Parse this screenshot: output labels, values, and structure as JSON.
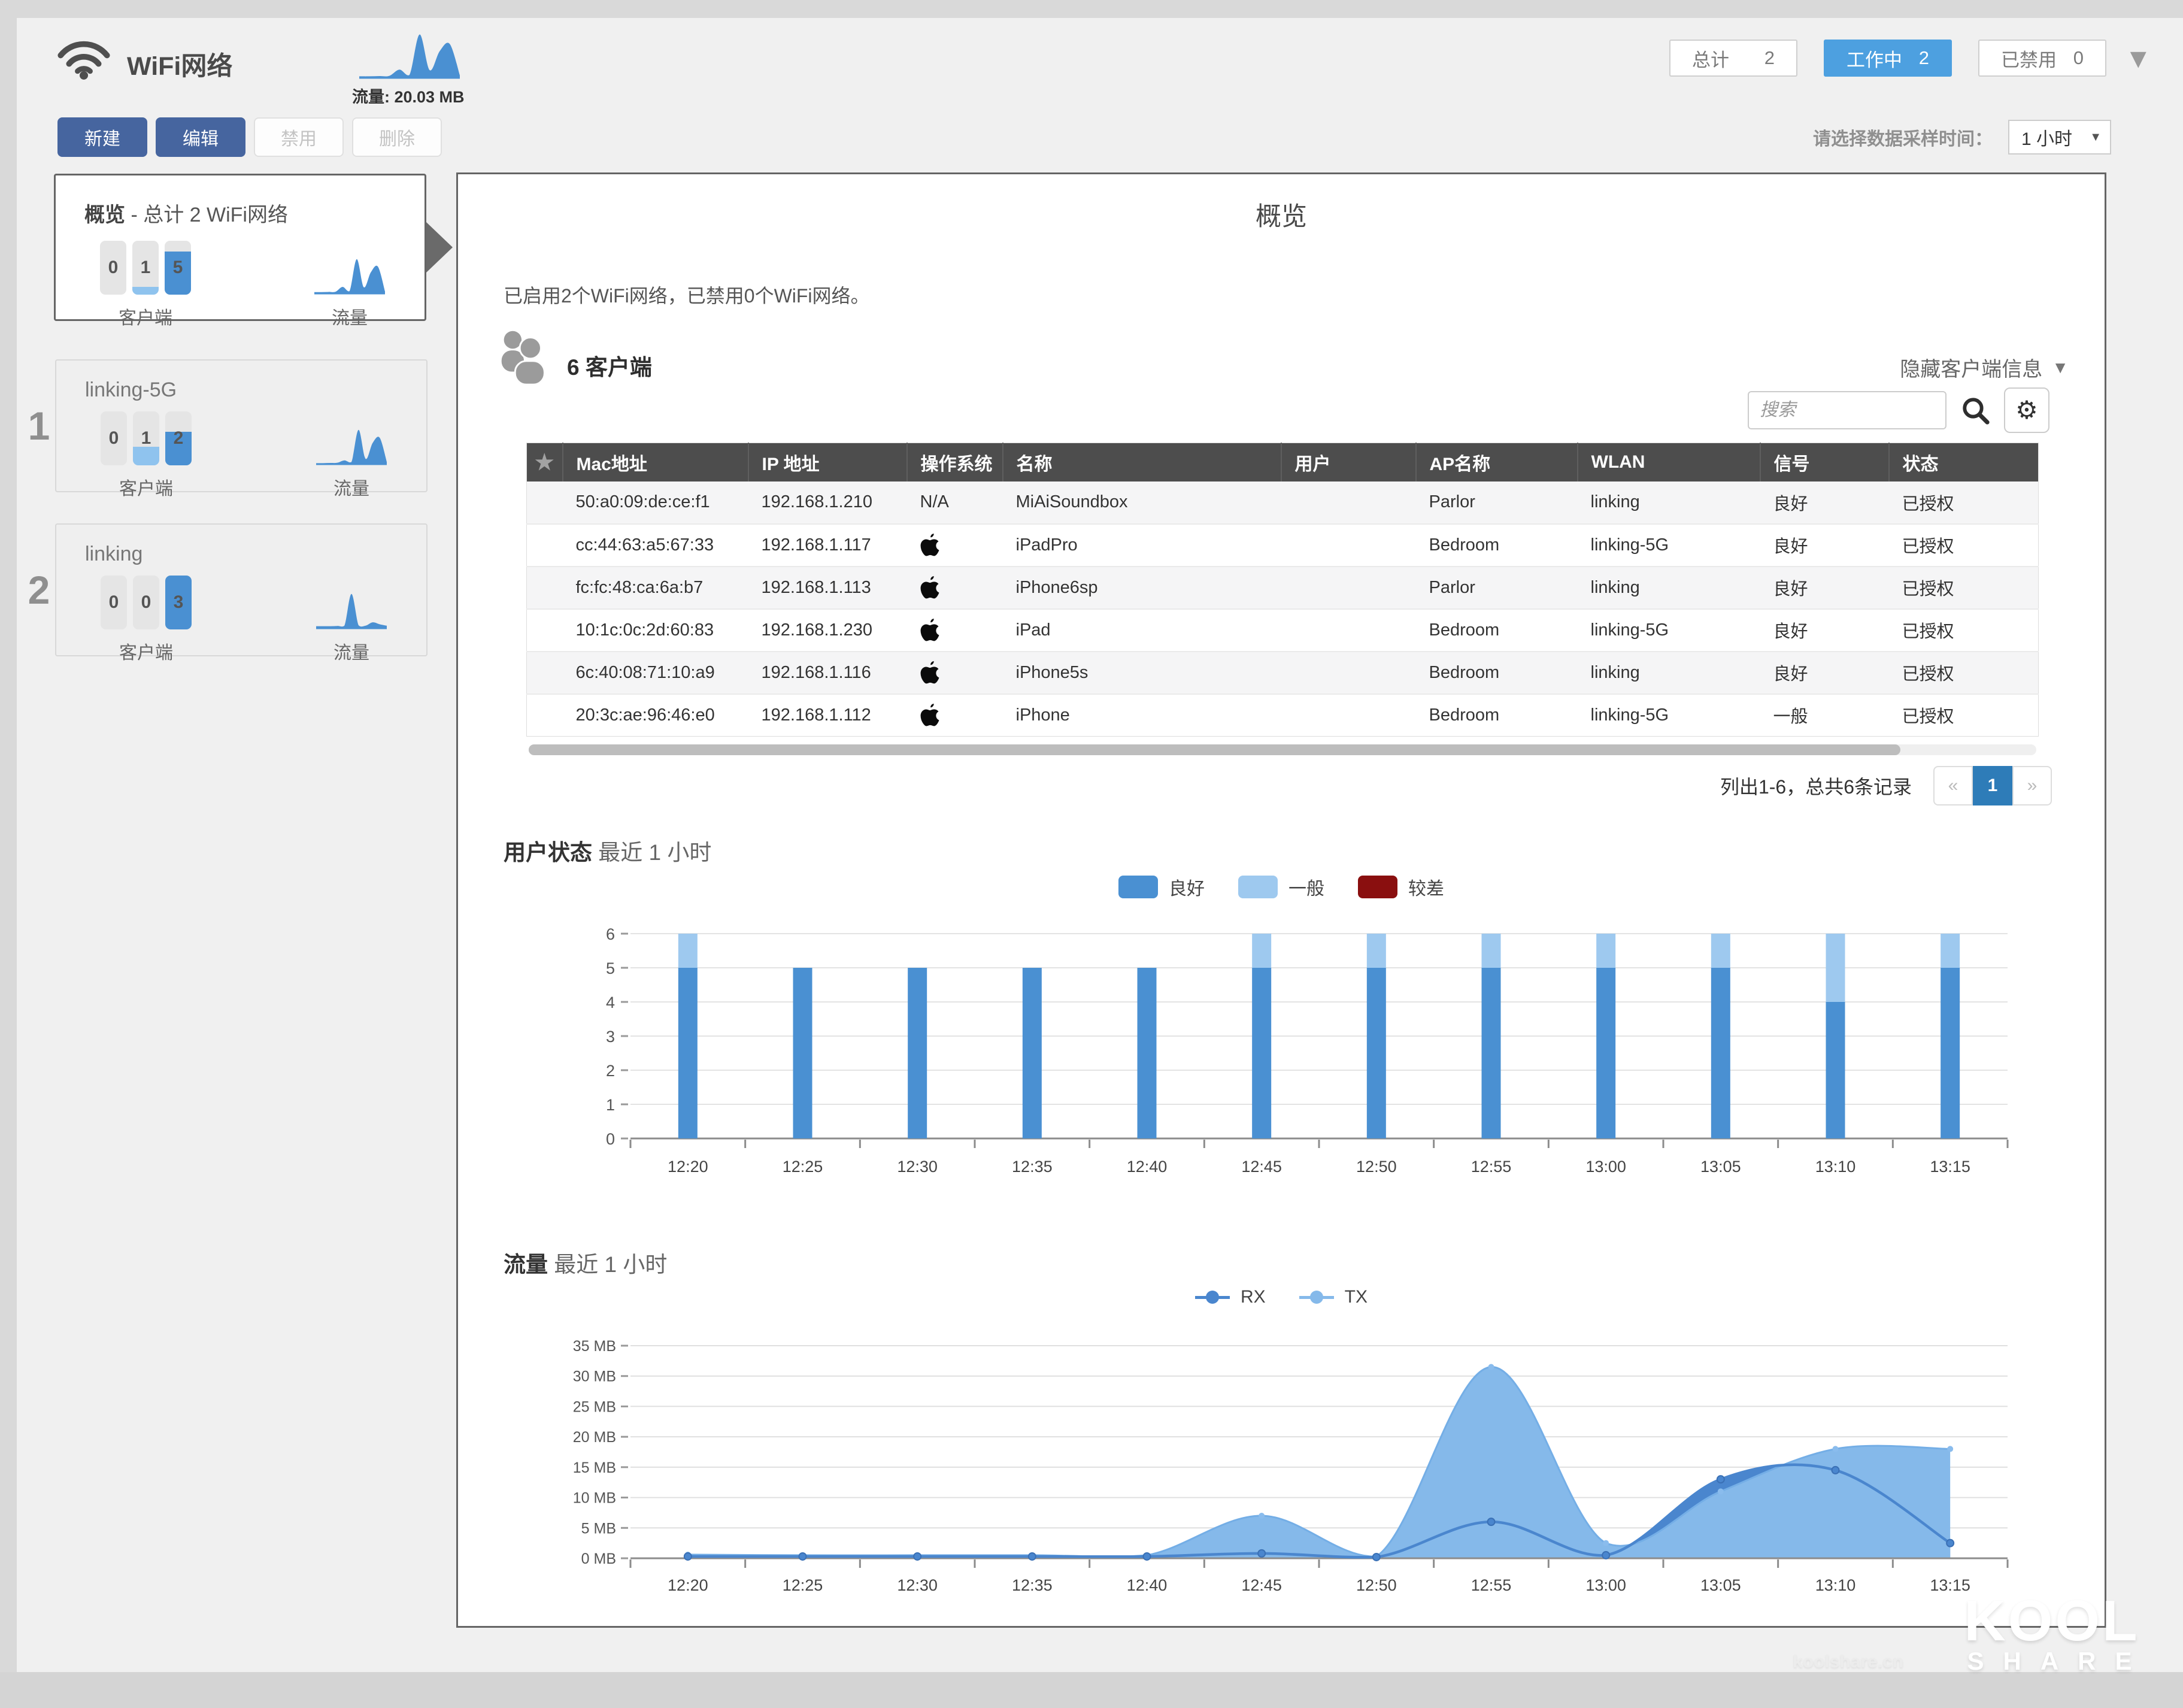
{
  "colors": {
    "accent": "#4da0e0",
    "primary": "#46659f",
    "pager_active": "#2e7cb8",
    "bar_blue": "#4a90d2",
    "bar_light": "#8fc3ee",
    "table_header": "#4d4d4d"
  },
  "icons": {
    "caret_down": "▼",
    "gear": "⚙"
  },
  "header": {
    "title": "WiFi网络",
    "traffic_label": "流量: 20.03 MB",
    "traffic_spark": [
      0.2,
      0.2,
      0.25,
      0.3,
      1.6,
      0.5,
      9,
      1.5,
      5.5,
      7,
      0.4
    ],
    "filters": [
      {
        "label": "总计",
        "count": "2",
        "active": false
      },
      {
        "label": "工作中",
        "count": "2",
        "active": true
      },
      {
        "label": "已禁用",
        "count": "0",
        "active": false
      }
    ]
  },
  "toolbar": {
    "buttons": [
      {
        "label": "新建",
        "enabled": true
      },
      {
        "label": "编辑",
        "enabled": true
      },
      {
        "label": "禁用",
        "enabled": false
      },
      {
        "label": "删除",
        "enabled": false
      }
    ],
    "sample_label": "请选择数据采样时间：",
    "sample_value": "1 小时"
  },
  "sidebar": {
    "overview": {
      "title_bold": "概览",
      "title_rest": " - 总计 2 WiFi网络",
      "clients_label": "客户端",
      "traffic_label": "流量",
      "client_bars": [
        {
          "value": "0",
          "fill": 0,
          "variant": "none"
        },
        {
          "value": "1",
          "fill": 0.14,
          "variant": "light"
        },
        {
          "value": "5",
          "fill": 0.8,
          "variant": "blue"
        }
      ],
      "spark": [
        0.2,
        0.2,
        0.25,
        0.3,
        1.6,
        0.5,
        9,
        1.5,
        5.5,
        7,
        0.4
      ]
    },
    "networks": [
      {
        "index": "1",
        "name": "linking-5G",
        "clients_label": "客户端",
        "traffic_label": "流量",
        "client_bars": [
          {
            "value": "0",
            "fill": 0,
            "variant": "none"
          },
          {
            "value": "1",
            "fill": 0.35,
            "variant": "light"
          },
          {
            "value": "2",
            "fill": 0.62,
            "variant": "blue"
          }
        ],
        "spark": [
          0.1,
          0.1,
          0.15,
          0.2,
          0.8,
          0.4,
          8.5,
          1.2,
          5.2,
          6.5,
          0.4
        ]
      },
      {
        "index": "2",
        "name": "linking",
        "clients_label": "客户端",
        "traffic_label": "流量",
        "client_bars": [
          {
            "value": "0",
            "fill": 0,
            "variant": "none"
          },
          {
            "value": "0",
            "fill": 0,
            "variant": "none"
          },
          {
            "value": "3",
            "fill": 1,
            "variant": "blue"
          }
        ],
        "spark": [
          0.3,
          0.3,
          0.3,
          0.35,
          0.4,
          7,
          0.5,
          0.4,
          1.1,
          0.7,
          0.4
        ]
      }
    ]
  },
  "main": {
    "title": "概览",
    "summary": "已启用2个WiFi网络，已禁用0个WiFi网络。",
    "clients_heading": "6 客户端",
    "hide_info": "隐藏客户端信息",
    "search_placeholder": "搜索",
    "table": {
      "columns": [
        "★",
        "Mac地址",
        "IP 地址",
        "操作系统",
        "名称",
        "用户",
        "AP名称",
        "WLAN",
        "信号",
        "状态"
      ],
      "rows": [
        {
          "mac": "50:a0:09:de:ce:f1",
          "ip": "192.168.1.210",
          "os": "N/A",
          "name": "MiAiSoundbox",
          "user": "",
          "ap": "Parlor",
          "wlan": "linking",
          "signal": "良好",
          "status": "已授权"
        },
        {
          "mac": "cc:44:63:a5:67:33",
          "ip": "192.168.1.117",
          "os": "apple",
          "name": "iPadPro",
          "user": "",
          "ap": "Bedroom",
          "wlan": "linking-5G",
          "signal": "良好",
          "status": "已授权"
        },
        {
          "mac": "fc:fc:48:ca:6a:b7",
          "ip": "192.168.1.113",
          "os": "apple",
          "name": "iPhone6sp",
          "user": "",
          "ap": "Parlor",
          "wlan": "linking",
          "signal": "良好",
          "status": "已授权"
        },
        {
          "mac": "10:1c:0c:2d:60:83",
          "ip": "192.168.1.230",
          "os": "apple",
          "name": "iPad",
          "user": "",
          "ap": "Bedroom",
          "wlan": "linking-5G",
          "signal": "良好",
          "status": "已授权"
        },
        {
          "mac": "6c:40:08:71:10:a9",
          "ip": "192.168.1.116",
          "os": "apple",
          "name": "iPhone5s",
          "user": "",
          "ap": "Bedroom",
          "wlan": "linking",
          "signal": "良好",
          "status": "已授权"
        },
        {
          "mac": "20:3c:ae:96:46:e0",
          "ip": "192.168.1.112",
          "os": "apple",
          "name": "iPhone",
          "user": "",
          "ap": "Bedroom",
          "wlan": "linking-5G",
          "signal": "一般",
          "status": "已授权"
        }
      ]
    },
    "pagination": {
      "summary": "列出1-6，总共6条记录",
      "prev": "«",
      "page": "1",
      "next": "»"
    },
    "sections": {
      "user_status": {
        "bold": "用户状态",
        "rest": "最近 1 小时"
      },
      "traffic": {
        "bold": "流量",
        "rest": "最近 1 小时"
      }
    }
  },
  "chart_data": [
    {
      "type": "bar",
      "stacked": true,
      "title": "用户状态 最近 1 小时",
      "categories": [
        "12:20",
        "12:25",
        "12:30",
        "12:35",
        "12:40",
        "12:45",
        "12:50",
        "12:55",
        "13:00",
        "13:05",
        "13:10",
        "13:15"
      ],
      "series": [
        {
          "name": "良好",
          "color": "#4a90d2",
          "values": [
            5,
            5,
            5,
            5,
            5,
            5,
            5,
            5,
            5,
            5,
            4,
            5
          ]
        },
        {
          "name": "一般",
          "color": "#9ec9ef",
          "values": [
            1,
            0,
            0,
            0,
            0,
            1,
            1,
            1,
            1,
            1,
            2,
            1
          ]
        },
        {
          "name": "较差",
          "color": "#8a0f0f",
          "values": [
            0,
            0,
            0,
            0,
            0,
            0,
            0,
            0,
            0,
            0,
            0,
            0
          ]
        }
      ],
      "xlabel": "",
      "ylabel": "",
      "ylim": [
        0,
        6
      ],
      "ytick_step": 1,
      "grid": true,
      "legend_position": "top-center"
    },
    {
      "type": "area",
      "title": "流量 最近 1 小时",
      "x": [
        "12:20",
        "12:25",
        "12:30",
        "12:35",
        "12:40",
        "12:45",
        "12:50",
        "12:55",
        "13:00",
        "13:05",
        "13:10",
        "13:15"
      ],
      "series": [
        {
          "name": "RX",
          "color": "#4a86ce",
          "values": [
            0.3,
            0.3,
            0.3,
            0.3,
            0.3,
            0.8,
            0.2,
            6,
            0.5,
            13,
            14.5,
            2.5
          ]
        },
        {
          "name": "TX",
          "color": "#85b9ea",
          "values": [
            0.6,
            0.5,
            0.5,
            0.5,
            0.5,
            7,
            0.3,
            31.5,
            2.5,
            11,
            18,
            18
          ]
        }
      ],
      "xlabel": "",
      "ylabel": "",
      "yunit": "MB",
      "ylim": [
        0,
        35
      ],
      "ytick_step": 5,
      "grid": true,
      "legend_position": "top-center"
    }
  ],
  "watermark": {
    "site": "koolshare.cn",
    "logo_top": "KOOL",
    "logo_bottom": "SHARE"
  }
}
